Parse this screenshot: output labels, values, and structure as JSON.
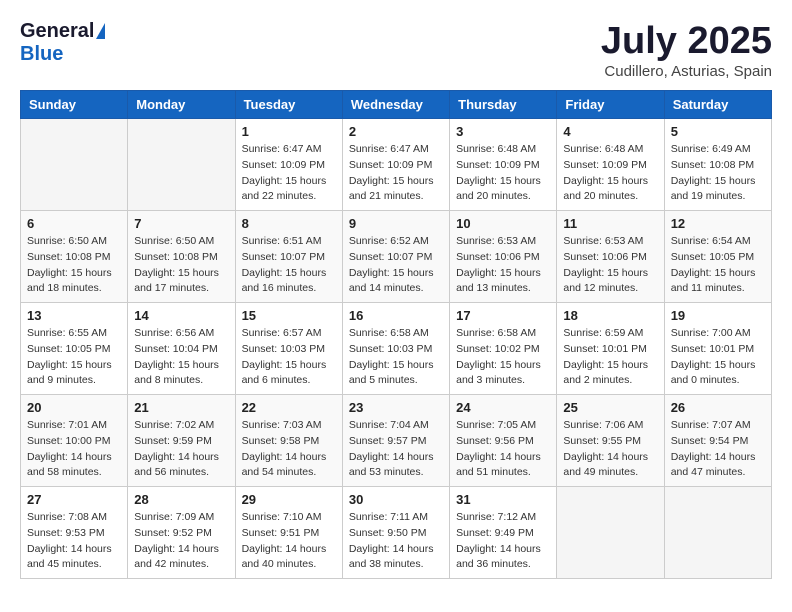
{
  "logo": {
    "general": "General",
    "blue": "Blue"
  },
  "title": "July 2025",
  "location": "Cudillero, Asturias, Spain",
  "days_of_week": [
    "Sunday",
    "Monday",
    "Tuesday",
    "Wednesday",
    "Thursday",
    "Friday",
    "Saturday"
  ],
  "weeks": [
    [
      {
        "day": "",
        "detail": ""
      },
      {
        "day": "",
        "detail": ""
      },
      {
        "day": "1",
        "detail": "Sunrise: 6:47 AM\nSunset: 10:09 PM\nDaylight: 15 hours\nand 22 minutes."
      },
      {
        "day": "2",
        "detail": "Sunrise: 6:47 AM\nSunset: 10:09 PM\nDaylight: 15 hours\nand 21 minutes."
      },
      {
        "day": "3",
        "detail": "Sunrise: 6:48 AM\nSunset: 10:09 PM\nDaylight: 15 hours\nand 20 minutes."
      },
      {
        "day": "4",
        "detail": "Sunrise: 6:48 AM\nSunset: 10:09 PM\nDaylight: 15 hours\nand 20 minutes."
      },
      {
        "day": "5",
        "detail": "Sunrise: 6:49 AM\nSunset: 10:08 PM\nDaylight: 15 hours\nand 19 minutes."
      }
    ],
    [
      {
        "day": "6",
        "detail": "Sunrise: 6:50 AM\nSunset: 10:08 PM\nDaylight: 15 hours\nand 18 minutes."
      },
      {
        "day": "7",
        "detail": "Sunrise: 6:50 AM\nSunset: 10:08 PM\nDaylight: 15 hours\nand 17 minutes."
      },
      {
        "day": "8",
        "detail": "Sunrise: 6:51 AM\nSunset: 10:07 PM\nDaylight: 15 hours\nand 16 minutes."
      },
      {
        "day": "9",
        "detail": "Sunrise: 6:52 AM\nSunset: 10:07 PM\nDaylight: 15 hours\nand 14 minutes."
      },
      {
        "day": "10",
        "detail": "Sunrise: 6:53 AM\nSunset: 10:06 PM\nDaylight: 15 hours\nand 13 minutes."
      },
      {
        "day": "11",
        "detail": "Sunrise: 6:53 AM\nSunset: 10:06 PM\nDaylight: 15 hours\nand 12 minutes."
      },
      {
        "day": "12",
        "detail": "Sunrise: 6:54 AM\nSunset: 10:05 PM\nDaylight: 15 hours\nand 11 minutes."
      }
    ],
    [
      {
        "day": "13",
        "detail": "Sunrise: 6:55 AM\nSunset: 10:05 PM\nDaylight: 15 hours\nand 9 minutes."
      },
      {
        "day": "14",
        "detail": "Sunrise: 6:56 AM\nSunset: 10:04 PM\nDaylight: 15 hours\nand 8 minutes."
      },
      {
        "day": "15",
        "detail": "Sunrise: 6:57 AM\nSunset: 10:03 PM\nDaylight: 15 hours\nand 6 minutes."
      },
      {
        "day": "16",
        "detail": "Sunrise: 6:58 AM\nSunset: 10:03 PM\nDaylight: 15 hours\nand 5 minutes."
      },
      {
        "day": "17",
        "detail": "Sunrise: 6:58 AM\nSunset: 10:02 PM\nDaylight: 15 hours\nand 3 minutes."
      },
      {
        "day": "18",
        "detail": "Sunrise: 6:59 AM\nSunset: 10:01 PM\nDaylight: 15 hours\nand 2 minutes."
      },
      {
        "day": "19",
        "detail": "Sunrise: 7:00 AM\nSunset: 10:01 PM\nDaylight: 15 hours\nand 0 minutes."
      }
    ],
    [
      {
        "day": "20",
        "detail": "Sunrise: 7:01 AM\nSunset: 10:00 PM\nDaylight: 14 hours\nand 58 minutes."
      },
      {
        "day": "21",
        "detail": "Sunrise: 7:02 AM\nSunset: 9:59 PM\nDaylight: 14 hours\nand 56 minutes."
      },
      {
        "day": "22",
        "detail": "Sunrise: 7:03 AM\nSunset: 9:58 PM\nDaylight: 14 hours\nand 54 minutes."
      },
      {
        "day": "23",
        "detail": "Sunrise: 7:04 AM\nSunset: 9:57 PM\nDaylight: 14 hours\nand 53 minutes."
      },
      {
        "day": "24",
        "detail": "Sunrise: 7:05 AM\nSunset: 9:56 PM\nDaylight: 14 hours\nand 51 minutes."
      },
      {
        "day": "25",
        "detail": "Sunrise: 7:06 AM\nSunset: 9:55 PM\nDaylight: 14 hours\nand 49 minutes."
      },
      {
        "day": "26",
        "detail": "Sunrise: 7:07 AM\nSunset: 9:54 PM\nDaylight: 14 hours\nand 47 minutes."
      }
    ],
    [
      {
        "day": "27",
        "detail": "Sunrise: 7:08 AM\nSunset: 9:53 PM\nDaylight: 14 hours\nand 45 minutes."
      },
      {
        "day": "28",
        "detail": "Sunrise: 7:09 AM\nSunset: 9:52 PM\nDaylight: 14 hours\nand 42 minutes."
      },
      {
        "day": "29",
        "detail": "Sunrise: 7:10 AM\nSunset: 9:51 PM\nDaylight: 14 hours\nand 40 minutes."
      },
      {
        "day": "30",
        "detail": "Sunrise: 7:11 AM\nSunset: 9:50 PM\nDaylight: 14 hours\nand 38 minutes."
      },
      {
        "day": "31",
        "detail": "Sunrise: 7:12 AM\nSunset: 9:49 PM\nDaylight: 14 hours\nand 36 minutes."
      },
      {
        "day": "",
        "detail": ""
      },
      {
        "day": "",
        "detail": ""
      }
    ]
  ]
}
